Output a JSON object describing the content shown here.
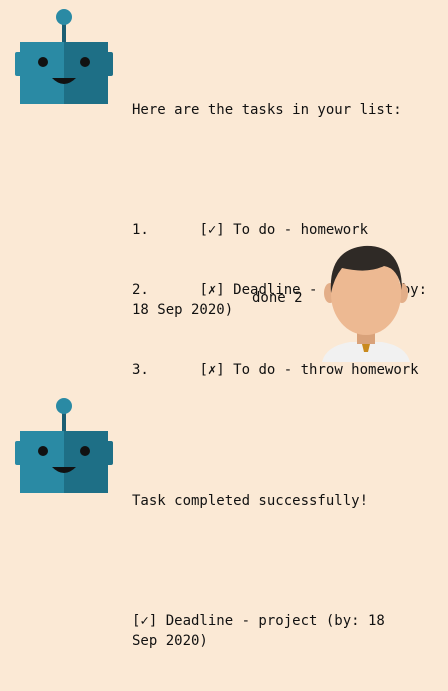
{
  "conversation": {
    "bot_message_1": {
      "intro": "Here are the tasks in your list:",
      "tasks": [
        {
          "index": "1.",
          "status": "[✓]",
          "text": "To do - homework"
        },
        {
          "index": "2.",
          "status": "[✗]",
          "text": "Deadline - project (by: 18 Sep 2020)"
        },
        {
          "index": "3.",
          "status": "[✗]",
          "text": "To do - throw homework"
        }
      ]
    },
    "user_message": {
      "text": "done 2"
    },
    "bot_message_2": {
      "line1": "Task completed successfully!",
      "line2": "[✓] Deadline - project (by: 18 Sep 2020)"
    }
  },
  "icons": {
    "bot": "robot-icon",
    "user": "user-avatar-icon"
  }
}
